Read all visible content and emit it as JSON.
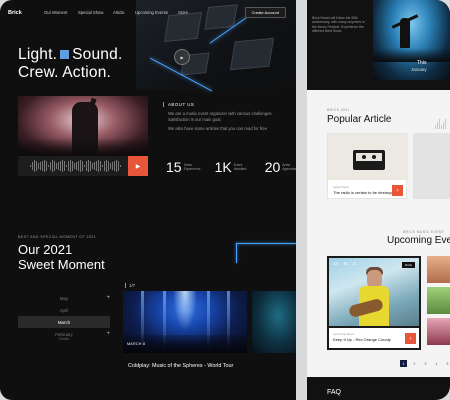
{
  "nav": {
    "logo": "Brick",
    "links": [
      "Our Moment",
      "Special Show",
      "Article",
      "Upcoming Events",
      "Store"
    ],
    "cta": "Create Account"
  },
  "hero": {
    "line1a": "Light.",
    "line1b": "Sound.",
    "line2": "Crew. Action.",
    "orb_icon": "play-icon"
  },
  "about": {
    "label": "ABOUT US",
    "p1": "We are a music event organizer with various challenges. Satisfaction is our main goal.",
    "p2": "We also have some articles that you can read for free",
    "stats": [
      {
        "value": "15",
        "label": "Years Experience"
      },
      {
        "value": "1K",
        "label": "Event Handled"
      },
      {
        "value": "20",
        "label": "Artist Agencies"
      }
    ]
  },
  "moment": {
    "label": "BEST AND SPECIAL MOMENT OF 2021",
    "title_line1": "Our 2021",
    "title_line2": "Sweet Moment",
    "months": [
      {
        "name": "May",
        "sub": "",
        "active": false,
        "plus": true
      },
      {
        "name": "April",
        "sub": "",
        "active": false,
        "plus": false
      },
      {
        "name": "March",
        "sub": "",
        "active": true,
        "plus": false
      },
      {
        "name": "February",
        "sub": "Details",
        "active": false,
        "plus": true
      }
    ],
    "slide_counter": "1/7",
    "slide_tag": "MARCH 8",
    "slide_caption": "Coldplay: Music of the Spheres - World Tour"
  },
  "right": {
    "top_text": "Brick Brand will follow the 50th anniversary, with many surprises in the Music Festival. Experience the different Best Show.",
    "date_this": "This",
    "date_month": "January",
    "popular_label": "BRICK 2021",
    "popular_title": "Popular Article",
    "card_tag": "Latest News",
    "card_caption": "The radio is certain to be destroyed",
    "events_label": "BRICK MUSIC EVENT",
    "events_title": "Upcoming Events",
    "event_meta": [
      "12K",
      "4K",
      "1K"
    ],
    "event_badge": "Rock",
    "event_sub": "Upcoming Event",
    "event_caption": "Keep It Up - Rex Orange County",
    "pages": [
      "1",
      "2",
      "3",
      "4",
      "5"
    ],
    "footer": "FAQ"
  },
  "colors": {
    "accent": "#e8563a",
    "blue": "#5d9de0",
    "dark": "#0f0f10"
  }
}
